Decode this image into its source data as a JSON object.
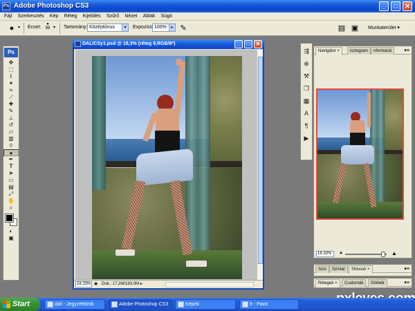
{
  "app": {
    "title": "Adobe Photoshop CS3",
    "ps_logo": "Ps",
    "min_glyph": "_",
    "max_glyph": "□",
    "close_glyph": "✕"
  },
  "menu": [
    "Fájl",
    "Szerkesztés",
    "Kép",
    "Réteg",
    "Kijelölés",
    "Szűrő",
    "Nézet",
    "Ablak",
    "Súgó"
  ],
  "options": {
    "brush_label": "Ecset:",
    "brush_size": "98",
    "range_label": "Tartomány:",
    "range_value": "Középtónus",
    "exposure_label": "Expozíció:",
    "exposure_value": "100%",
    "workspace_label": "Munkaterület",
    "dropdown_glyph": "▾"
  },
  "document": {
    "title": "DALICSy1.psd @ 18,3% (réteg 9,RGB/8*)",
    "zoom": "18,33%",
    "info": "Dok.: 17,2M/183,0M"
  },
  "navigator": {
    "tabs": [
      "Navigátor",
      "isztogram",
      "nformáció"
    ],
    "zoom": "18,33%"
  },
  "color_panel": {
    "tabs": [
      "Szín",
      "Színtár",
      "Stílusok"
    ]
  },
  "layers_panel": {
    "tabs": [
      "Rétegek",
      "Csatornák",
      "Görbék"
    ]
  },
  "taskbar": {
    "start_label": "Start",
    "tasks": [
      "dali - Jegyzettömb",
      "Adobe Photoshop CS3",
      "Képek",
      "9 - Paint"
    ]
  },
  "watermark": "pxleyes.com",
  "colors": {
    "titlebar": "#0b47c6",
    "taskbar": "#245edb",
    "start": "#34902f"
  }
}
